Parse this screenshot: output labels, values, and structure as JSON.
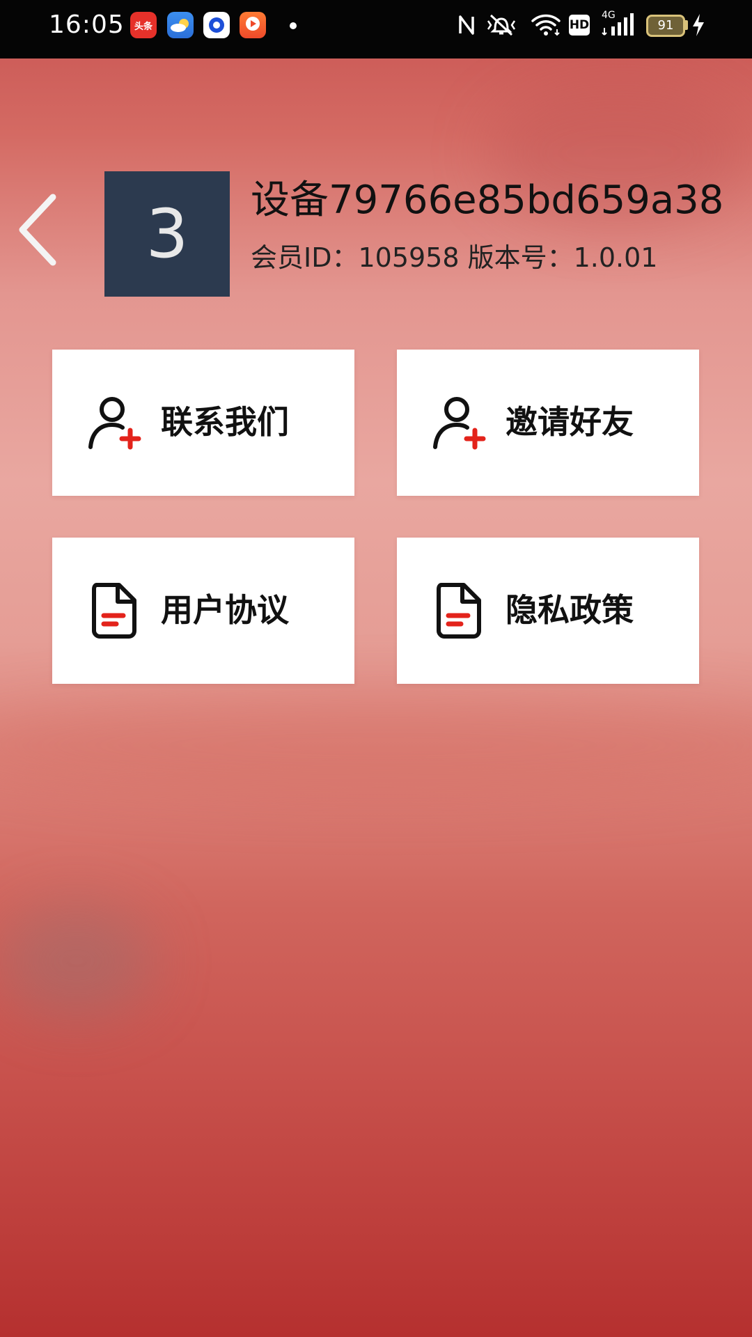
{
  "status_bar": {
    "time": "16:05",
    "app_icons": [
      "toutiao-icon",
      "weather-icon",
      "circle-app-icon",
      "video-app-icon"
    ],
    "toutiao_label": "头条",
    "system_icons": [
      "nfc-icon",
      "vibrate-icon",
      "wifi-icon",
      "hd-icon",
      "signal-4g-icon",
      "battery-icon",
      "charging-icon"
    ],
    "hd_label": "HD",
    "network_label": "4G",
    "battery_level": "91"
  },
  "header": {
    "back_icon": "chevron-left-icon",
    "avatar_text": "3",
    "device_name": "设备79766e85bd659a38",
    "member_info": "会员ID：105958 版本号：1.0.01"
  },
  "menu": [
    {
      "label": "联系我们",
      "icon": "add-user-icon"
    },
    {
      "label": "邀请好友",
      "icon": "add-user-icon"
    },
    {
      "label": "用户协议",
      "icon": "document-icon"
    },
    {
      "label": "隐私政策",
      "icon": "document-icon"
    }
  ],
  "colors": {
    "status_bar_bg": "#050505",
    "accent_red": "#e3231b",
    "avatar_bg": "#2c3a4f",
    "card_bg": "#ffffff",
    "background_top": "#c85452",
    "background_bottom": "#b5302f"
  }
}
